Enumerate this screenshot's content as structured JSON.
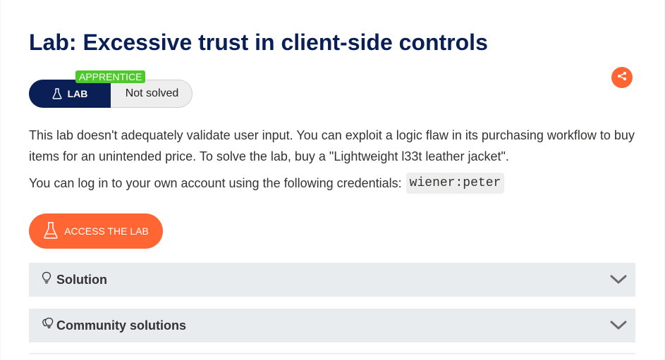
{
  "lab": {
    "title": "Lab: Excessive trust in client-side controls",
    "level": "APPRENTICE",
    "type_label": "LAB",
    "status": "Not solved"
  },
  "description": {
    "paragraph": "This lab doesn't adequately validate user input. You can exploit a logic flaw in its purchasing workflow to buy items for an unintended price. To solve the lab, buy a \"Lightweight l33t leather jacket\".",
    "credentials_text": "You can log in to your own account using the following credentials:",
    "credentials_value": "wiener:peter"
  },
  "actions": {
    "access_label": "ACCESS THE LAB"
  },
  "accordions": [
    {
      "label": "Solution",
      "icon": "lightbulb-icon"
    },
    {
      "label": "Community solutions",
      "icon": "lightbulbs-icon"
    }
  ],
  "colors": {
    "navy": "#0a1f56",
    "accent": "#ff6633",
    "level_green": "#4ec92b",
    "accordion_bg": "#e9ecee"
  }
}
